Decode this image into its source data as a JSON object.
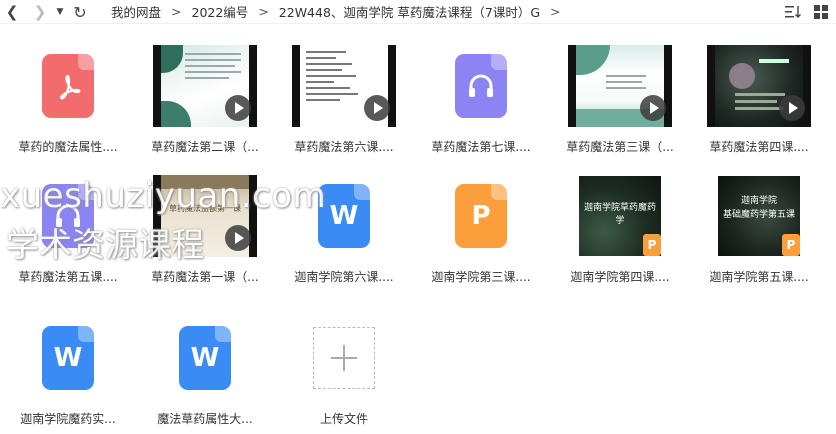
{
  "toolbar": {
    "breadcrumbs": [
      "我的网盘",
      "2022编号",
      "22W448、迦南学院 草药魔法课程（7课时）G"
    ],
    "separator": ">",
    "trail_marker": ">",
    "sort_icon": "sort-icon",
    "view_icon": "grid-view-icon"
  },
  "files": [
    {
      "name": "草药的魔法属性....",
      "type": "pdf"
    },
    {
      "name": "草药魔法第二课（...",
      "type": "video"
    },
    {
      "name": "草药魔法第六课....",
      "type": "video"
    },
    {
      "name": "草药魔法第七课....",
      "type": "audio"
    },
    {
      "name": "草药魔法第三课（...",
      "type": "video"
    },
    {
      "name": "草药魔法第四课....",
      "type": "video"
    },
    {
      "name": "草药魔法第五课....",
      "type": "audio"
    },
    {
      "name": "草药魔法第一课（...",
      "type": "video",
      "thumb_text": "草药魔法益额第一课"
    },
    {
      "name": "迦南学院第六课....",
      "type": "word"
    },
    {
      "name": "迦南学院第三课....",
      "type": "ppt"
    },
    {
      "name": "迦南学院第四课....",
      "type": "pptimg",
      "thumb_text": "迦南学院草药魔药学"
    },
    {
      "name": "迦南学院第五课....",
      "type": "pptimg",
      "thumb_text": "迦南学院\n基础魔药学第五课"
    },
    {
      "name": "迦南学院魔药实...",
      "type": "word"
    },
    {
      "name": "魔法草药属性大...",
      "type": "word"
    },
    {
      "name": "上传文件",
      "type": "upload"
    }
  ],
  "watermark": {
    "line1": "xueshuziyuan.com",
    "line2": "学术资源课程"
  },
  "colors": {
    "pdf": "#f26b6d",
    "word": "#3a8cf4",
    "ppt": "#fb9e3b",
    "audio": "#8c83f5"
  }
}
